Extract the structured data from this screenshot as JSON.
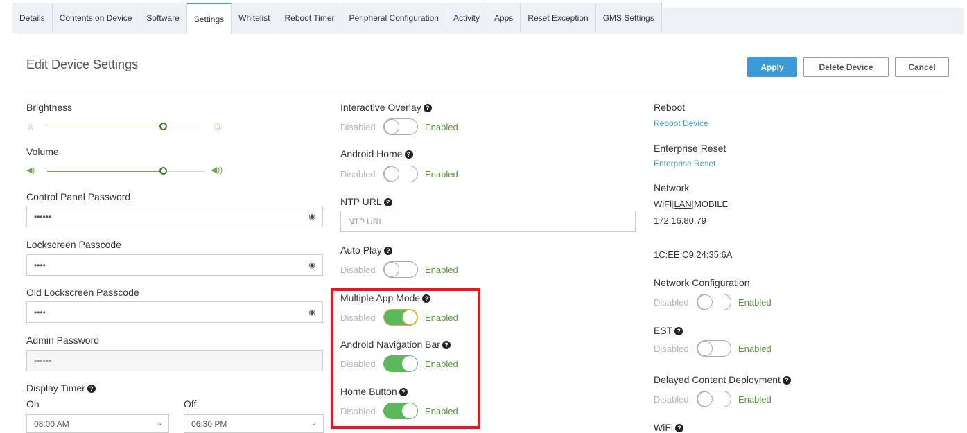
{
  "tabs": [
    "Details",
    "Contents on Device",
    "Software",
    "Settings",
    "Whitelist",
    "Reboot Timer",
    "Peripheral Configuration",
    "Activity",
    "Apps",
    "Reset Exception",
    "GMS Settings"
  ],
  "active_tab": "Settings",
  "header": {
    "title": "Edit Device Settings",
    "apply": "Apply",
    "delete": "Delete Device",
    "cancel": "Cancel"
  },
  "left": {
    "brightness": {
      "label": "Brightness",
      "level_percent": 75
    },
    "volume": {
      "label": "Volume",
      "level_percent": 75
    },
    "control_panel_password": {
      "label": "Control Panel Password",
      "value": "••••••"
    },
    "lockscreen_passcode": {
      "label": "Lockscreen Passcode",
      "value": "••••"
    },
    "old_lockscreen_passcode": {
      "label": "Old Lockscreen Passcode",
      "value": "••••"
    },
    "admin_password": {
      "label": "Admin Password",
      "value": "••••••"
    },
    "display_timer": {
      "label": "Display Timer",
      "on_label": "On",
      "off_label": "Off",
      "on_value": "08:00 AM",
      "off_value": "06:30 PM"
    }
  },
  "toggle_text": {
    "disabled": "Disabled",
    "enabled": "Enabled"
  },
  "middle": {
    "interactive_overlay": {
      "label": "Interactive Overlay",
      "on": false
    },
    "android_home": {
      "label": "Android Home",
      "on": false
    },
    "ntp_url": {
      "label": "NTP URL",
      "placeholder": "NTP URL"
    },
    "auto_play": {
      "label": "Auto Play",
      "on": false
    },
    "multiple_app_mode": {
      "label": "Multiple App Mode",
      "on": true
    },
    "android_navigation_bar": {
      "label": "Android Navigation Bar",
      "on": true
    },
    "home_button": {
      "label": "Home Button",
      "on": true
    }
  },
  "right": {
    "reboot": {
      "label": "Reboot",
      "link": "Reboot Device"
    },
    "enterprise_reset": {
      "label": "Enterprise Reset",
      "link": "Enterprise Reset"
    },
    "network": {
      "label": "Network",
      "wifi": "WiFi",
      "lan": "LAN",
      "mobile": "MOBILE",
      "sep": "|",
      "ip": "172.16.80.79",
      "mac": "1C:EE:C9:24:35:6A"
    },
    "network_configuration": {
      "label": "Network Configuration",
      "on": false
    },
    "est": {
      "label": "EST",
      "on": false
    },
    "delayed_content_deployment": {
      "label": "Delayed Content Deployment",
      "on": false
    },
    "wifi": {
      "label": "WiFi"
    }
  },
  "colors": {
    "accent": "#3a9bd9",
    "toggle_on": "#5cb85c",
    "highlight": "#e8141e"
  }
}
